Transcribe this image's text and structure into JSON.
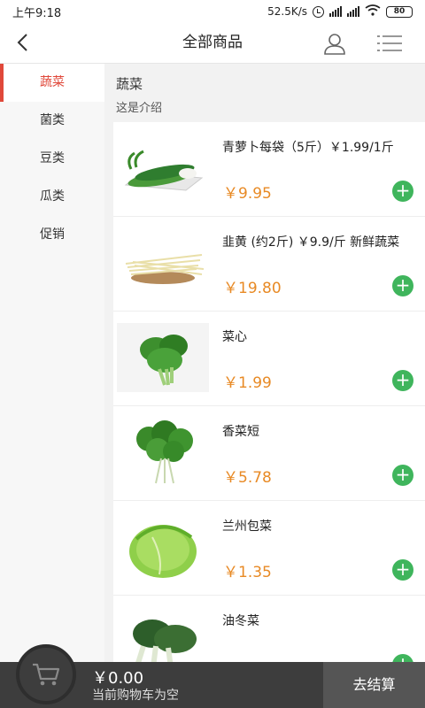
{
  "status_bar": {
    "time": "上午9:18",
    "network_speed": "52.5K/s",
    "battery": "80",
    "icons": [
      "alarm-icon",
      "signal-icon",
      "signal-icon",
      "wifi-icon",
      "battery-icon"
    ]
  },
  "header": {
    "title": "全部商品",
    "icons": [
      "back-icon",
      "user-icon",
      "menu-icon"
    ]
  },
  "sidebar": {
    "active_index": 0,
    "items": [
      {
        "label": "蔬菜"
      },
      {
        "label": "菌类"
      },
      {
        "label": "豆类"
      },
      {
        "label": "瓜类"
      },
      {
        "label": "促销"
      }
    ]
  },
  "section": {
    "title": "蔬菜",
    "description": "这是介绍"
  },
  "products": [
    {
      "name": "青萝卜每袋（5斤）￥1.99/1斤",
      "price": "￥9.95",
      "image": "radish"
    },
    {
      "name": "韭黄 (约2斤) ￥9.9/斤 新鲜蔬菜",
      "price": "￥19.80",
      "image": "chives"
    },
    {
      "name": "菜心",
      "price": "￥1.99",
      "image": "choy"
    },
    {
      "name": "香菜短",
      "price": "￥5.78",
      "image": "cilantro"
    },
    {
      "name": "兰州包菜",
      "price": "￥1.35",
      "image": "cabbage"
    },
    {
      "name": "油冬菜",
      "price": "",
      "image": "bokchoy"
    }
  ],
  "cart": {
    "total": "￥0.00",
    "status": "当前购物车为空",
    "checkout_label": "去结算"
  },
  "colors": {
    "accent": "#e0483a",
    "price": "#e88a25",
    "add_button": "#3fb55c",
    "bottom_bar": "#3d3d3d"
  }
}
